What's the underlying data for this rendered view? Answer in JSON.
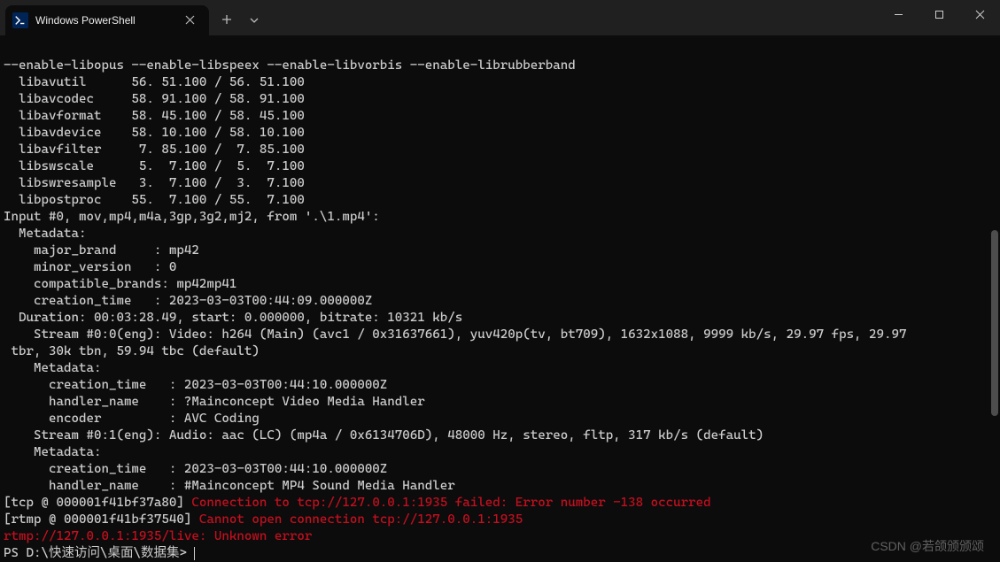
{
  "tab": {
    "title": "Windows PowerShell"
  },
  "lines": {
    "l0": "--enable-libopus --enable-libspeex --enable-libvorbis --enable-librubberband",
    "l1": "  libavutil      56. 51.100 / 56. 51.100",
    "l2": "  libavcodec     58. 91.100 / 58. 91.100",
    "l3": "  libavformat    58. 45.100 / 58. 45.100",
    "l4": "  libavdevice    58. 10.100 / 58. 10.100",
    "l5": "  libavfilter     7. 85.100 /  7. 85.100",
    "l6": "  libswscale      5.  7.100 /  5.  7.100",
    "l7": "  libswresample   3.  7.100 /  3.  7.100",
    "l8": "  libpostproc    55.  7.100 / 55.  7.100",
    "l9": "Input #0, mov,mp4,m4a,3gp,3g2,mj2, from '.\\1.mp4':",
    "l10": "  Metadata:",
    "l11": "    major_brand     : mp42",
    "l12": "    minor_version   : 0",
    "l13": "    compatible_brands: mp42mp41",
    "l14": "    creation_time   : 2023-03-03T00:44:09.000000Z",
    "l15": "  Duration: 00:03:28.49, start: 0.000000, bitrate: 10321 kb/s",
    "l16": "    Stream #0:0(eng): Video: h264 (Main) (avc1 / 0x31637661), yuv420p(tv, bt709), 1632x1088, 9999 kb/s, 29.97 fps, 29.97",
    "l17": " tbr, 30k tbn, 59.94 tbc (default)",
    "l18": "    Metadata:",
    "l19": "      creation_time   : 2023-03-03T00:44:10.000000Z",
    "l20": "      handler_name    : ?Mainconcept Video Media Handler",
    "l21": "      encoder         : AVC Coding",
    "l22": "    Stream #0:1(eng): Audio: aac (LC) (mp4a / 0x6134706D), 48000 Hz, stereo, fltp, 317 kb/s (default)",
    "l23": "    Metadata:",
    "l24": "      creation_time   : 2023-03-03T00:44:10.000000Z",
    "l25": "      handler_name    : #Mainconcept MP4 Sound Media Handler",
    "l26a": "[tcp @ 000001f41bf37a80] ",
    "l26b": "Connection to tcp://127.0.0.1:1935 failed: Error number -138 occurred",
    "l27a": "[rtmp @ 000001f41bf37540] ",
    "l27b": "Cannot open connection tcp://127.0.0.1:1935",
    "l28": "rtmp://127.0.0.1:1935/live: Unknown error",
    "prompt": "PS D:\\快速访问\\桌面\\数据集> "
  },
  "watermark": "CSDN @若颌颁颁颂"
}
